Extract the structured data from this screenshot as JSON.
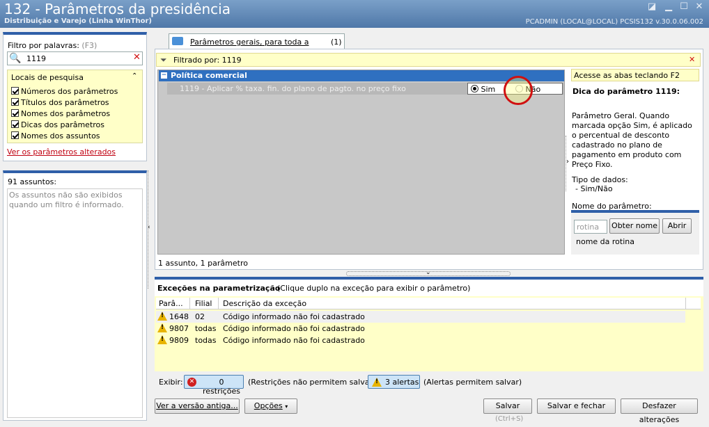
{
  "window": {
    "title": "132 - Parâmetros da presidência",
    "subtitle": "Distribuição e Varejo (Linha WinThor)",
    "userinfo": "PCADMIN (LOCAL@LOCAL)   PCSIS132  v.30.0.06.002"
  },
  "filter": {
    "label": "Filtro por palavras:",
    "shortcut": "(F3)",
    "value": "1119",
    "locais_title": "Locais de pesquisa",
    "options": [
      "Números dos parâmetros",
      "Títulos dos parâmetros",
      "Nomes dos parâmetros",
      "Dicas dos parâmetros",
      "Nomes dos assuntos"
    ],
    "link": "Ver os parâmetros alterados"
  },
  "assuntos": {
    "count_label": "91 assuntos:",
    "note": "Os assuntos não são exibidos quando um filtro é informado."
  },
  "tab": {
    "label": "Parâmetros gerais, para toda a empresa",
    "count": "(1)"
  },
  "filterbar": {
    "text": "Filtrado por: 1119"
  },
  "grid": {
    "group": "Política comercial",
    "param": "1119 - Aplicar % taxa. fin. do plano de pagto. no preço fixo",
    "opt_yes": "Sim",
    "opt_no": "Não",
    "status": "1 assunto, 1 parâmetro"
  },
  "tip": {
    "hint": "Acesse as abas teclando F2",
    "title": "Dica do parâmetro 1119:",
    "body": "Parâmetro Geral. Quando marcada opção Sim, é aplicado o percentual de desconto cadastrado no plano de pagamento em produto com Preço Fixo.",
    "type_label": "Tipo de dados:",
    "type_value": "- Sim/Não",
    "name_label": "Nome do parâmetro:"
  },
  "rotina": {
    "placeholder": "rotina",
    "btn_obter": "Obter nome",
    "btn_abrir": "Abrir",
    "label": "nome da rotina"
  },
  "exceptions": {
    "title": "Exceções na parametrização",
    "subtitle": "(Clique duplo na exceção para exibir o parâmetro)",
    "columns": [
      "Parâ...",
      "Filial",
      "Descrição da exceção"
    ],
    "rows": [
      {
        "param": "1648",
        "filial": "02",
        "desc": "Código informado não foi cadastrado"
      },
      {
        "param": "9807",
        "filial": "todas",
        "desc": "Código informado não foi cadastrado"
      },
      {
        "param": "9809",
        "filial": "todas",
        "desc": "Código informado não foi cadastrado"
      }
    ]
  },
  "exibir": {
    "label": "Exibir:",
    "restr_btn": "0 restrições",
    "restr_note": "(Restrições não permitem salvar)",
    "alert_btn": "3 alertas",
    "alert_note": "(Alertas permitem salvar)"
  },
  "footer": {
    "versao": "Ver a versão antiga...",
    "opcoes": "Opções",
    "salvar": "Salvar",
    "salvar_shortcut": "(Ctrl+S)",
    "salvar_fechar": "Salvar e fechar",
    "desfazer": "Desfazer alterações"
  }
}
